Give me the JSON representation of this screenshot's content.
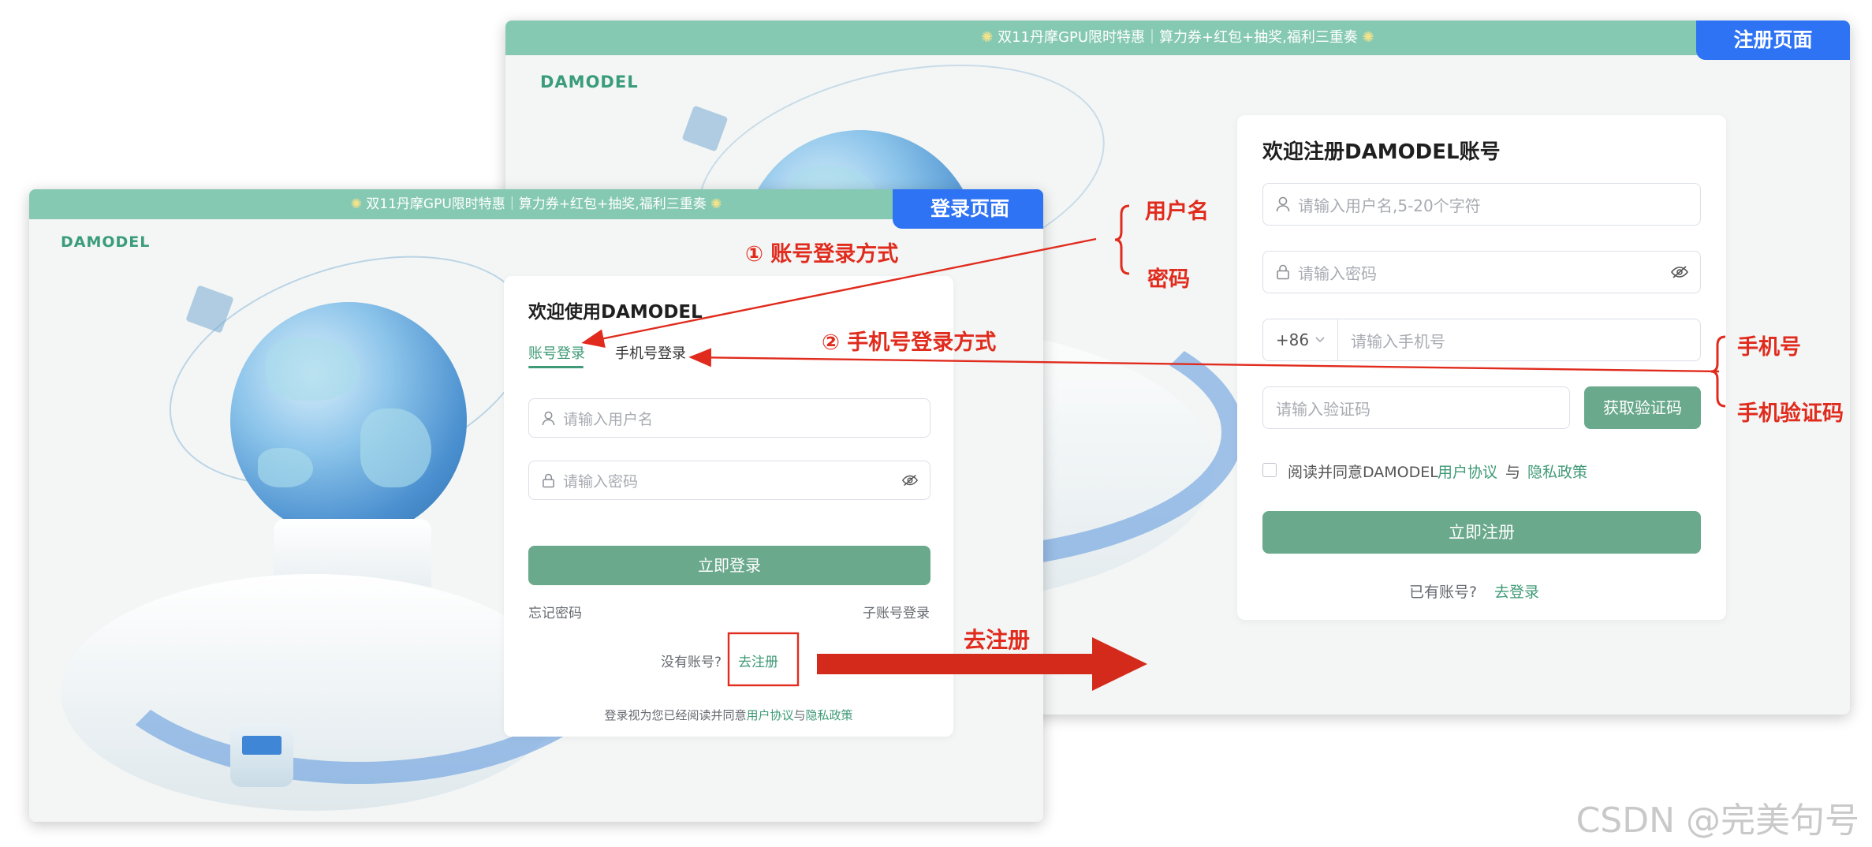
{
  "register_page": {
    "banner": "双11丹摩GPU限时特惠｜算力券+红包+抽奖,福利三重奏",
    "logo": "DAMODEL",
    "page_label": "注册页面",
    "title": "欢迎注册DAMODEL账号",
    "username_placeholder": "请输入用户名,5-20个字符",
    "password_placeholder": "请输入密码",
    "country_code": "+86",
    "phone_placeholder": "请输入手机号",
    "code_placeholder": "请输入验证码",
    "get_code_button": "获取验证码",
    "agree_text": "阅读并同意DAMODEL",
    "user_agreement": "用户协议",
    "and": "与",
    "privacy_policy": "隐私政策",
    "submit_button": "立即注册",
    "have_account": "已有账号?",
    "go_login": "去登录"
  },
  "login_page": {
    "banner": "双11丹摩GPU限时特惠｜算力券+红包+抽奖,福利三重奏",
    "logo": "DAMODEL",
    "page_label": "登录页面",
    "title": "欢迎使用DAMODEL",
    "tabs": [
      "账号登录",
      "手机号登录"
    ],
    "active_tab": 0,
    "username_placeholder": "请输入用户名",
    "password_placeholder": "请输入密码",
    "submit_button": "立即登录",
    "forgot_password": "忘记密码",
    "sub_account_login": "子账号登录",
    "no_account": "没有账号?",
    "go_register": "去注册",
    "terms_prefix": "登录视为您已经阅读并同意",
    "user_agreement": "用户协议",
    "and": "与",
    "privacy_policy": "隐私政策"
  },
  "annotations": {
    "account_login_method": "①  账号登录方式",
    "phone_login_method": "②  手机号登录方式",
    "username": "用户名",
    "password": "密码",
    "phone": "手机号",
    "phone_code": "手机验证码",
    "go_register": "去注册"
  },
  "watermark": "CSDN @完美句号",
  "colors": {
    "brand_green": "#6aa98c",
    "banner_green": "#86c9b3",
    "link_green": "#3f9a77",
    "label_blue": "#2f73f5",
    "annotation_red": "#e02b1d"
  }
}
